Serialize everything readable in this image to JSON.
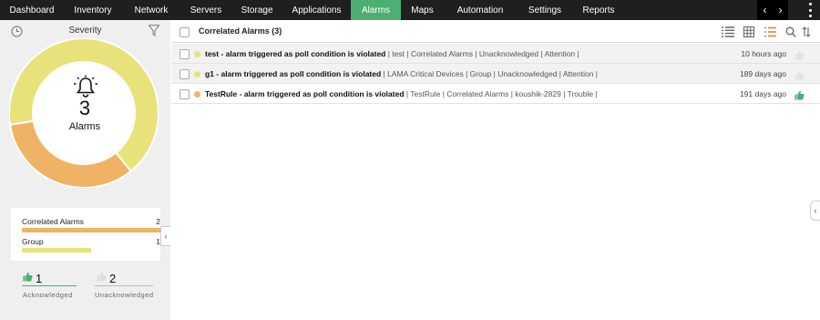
{
  "nav": {
    "tabs": [
      {
        "label": "Dashboard"
      },
      {
        "label": "Inventory"
      },
      {
        "label": "Network"
      },
      {
        "label": "Servers"
      },
      {
        "label": "Storage"
      },
      {
        "label": "Applications"
      },
      {
        "label": "Alarms"
      },
      {
        "label": "Maps"
      },
      {
        "label": "Automation"
      },
      {
        "label": "Settings"
      },
      {
        "label": "Reports"
      }
    ],
    "active": "Alarms",
    "prev_glyph": "‹",
    "next_glyph": "›"
  },
  "sidebar": {
    "title": "Severity",
    "donut": {
      "count": "3",
      "label": "Alarms",
      "segments": [
        {
          "name": "Correlated Alarms",
          "value": 2,
          "color": "#e8e27a"
        },
        {
          "name": "Group",
          "value": 1,
          "color": "#f0b264"
        }
      ]
    },
    "legend": [
      {
        "label": "Correlated Alarms",
        "count": "2",
        "color": "#f0b264"
      },
      {
        "label": "Group",
        "count": "1",
        "color": "#e8e27a"
      }
    ],
    "acknowledged": {
      "count": "1",
      "label": "Acknowledged"
    },
    "unacknowledged": {
      "count": "2",
      "label": "Unacknowledged"
    }
  },
  "main": {
    "header": "Correlated Alarms (3)",
    "rows": [
      {
        "title": "test - alarm triggered as poll condition is violated",
        "meta": " | test | Correlated Alarms | Unacknowledged | Attention |",
        "time": "10 hours ago",
        "dot": "#e8e27a",
        "acknowledged": false
      },
      {
        "title": "g1 - alarm triggered as poll condition is violated",
        "meta": " | LAMA Critical Devices | Group | Unacknowledged | Attention |",
        "time": "189 days ago",
        "dot": "#e8e27a",
        "acknowledged": false
      },
      {
        "title": "TestRule - alarm triggered as poll condition is violated",
        "meta": " | TestRule | Correlated Alarms | koushik-2829 | Trouble |",
        "time": "191 days ago",
        "dot": "#f0b264",
        "acknowledged": true
      }
    ]
  },
  "colors": {
    "nav_bg": "#1f1f1f",
    "active_tab": "#4caf72",
    "attention": "#e8e27a",
    "trouble": "#f0b264",
    "ack_green": "#4caf72"
  }
}
